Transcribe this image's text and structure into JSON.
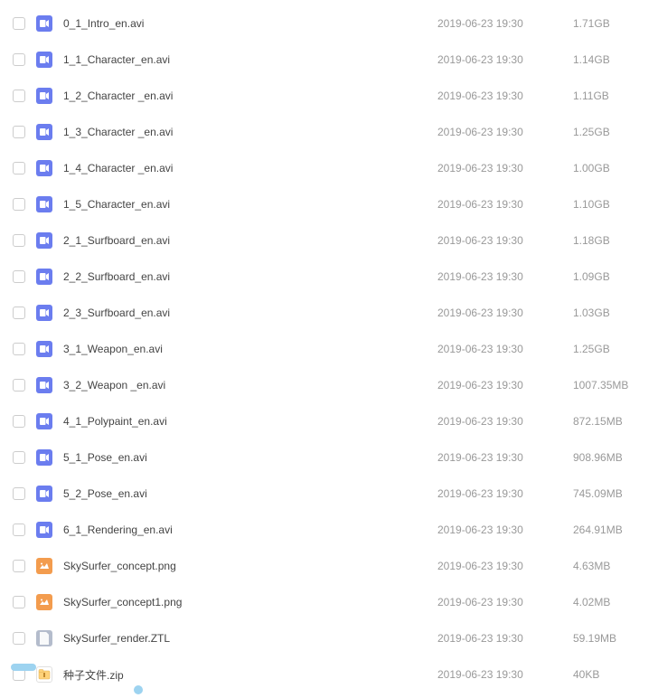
{
  "files": [
    {
      "name": "0_1_Intro_en.avi",
      "date": "2019-06-23 19:30",
      "size": "1.71GB",
      "type": "video"
    },
    {
      "name": "1_1_Character_en.avi",
      "date": "2019-06-23 19:30",
      "size": "1.14GB",
      "type": "video"
    },
    {
      "name": "1_2_Character _en.avi",
      "date": "2019-06-23 19:30",
      "size": "1.11GB",
      "type": "video"
    },
    {
      "name": "1_3_Character _en.avi",
      "date": "2019-06-23 19:30",
      "size": "1.25GB",
      "type": "video"
    },
    {
      "name": "1_4_Character _en.avi",
      "date": "2019-06-23 19:30",
      "size": "1.00GB",
      "type": "video"
    },
    {
      "name": "1_5_Character_en.avi",
      "date": "2019-06-23 19:30",
      "size": "1.10GB",
      "type": "video"
    },
    {
      "name": "2_1_Surfboard_en.avi",
      "date": "2019-06-23 19:30",
      "size": "1.18GB",
      "type": "video"
    },
    {
      "name": "2_2_Surfboard_en.avi",
      "date": "2019-06-23 19:30",
      "size": "1.09GB",
      "type": "video"
    },
    {
      "name": "2_3_Surfboard_en.avi",
      "date": "2019-06-23 19:30",
      "size": "1.03GB",
      "type": "video"
    },
    {
      "name": "3_1_Weapon_en.avi",
      "date": "2019-06-23 19:30",
      "size": "1.25GB",
      "type": "video"
    },
    {
      "name": "3_2_Weapon _en.avi",
      "date": "2019-06-23 19:30",
      "size": "1007.35MB",
      "type": "video"
    },
    {
      "name": "4_1_Polypaint_en.avi",
      "date": "2019-06-23 19:30",
      "size": "872.15MB",
      "type": "video"
    },
    {
      "name": "5_1_Pose_en.avi",
      "date": "2019-06-23 19:30",
      "size": "908.96MB",
      "type": "video"
    },
    {
      "name": "5_2_Pose_en.avi",
      "date": "2019-06-23 19:30",
      "size": "745.09MB",
      "type": "video"
    },
    {
      "name": "6_1_Rendering_en.avi",
      "date": "2019-06-23 19:30",
      "size": "264.91MB",
      "type": "video"
    },
    {
      "name": "SkySurfer_concept.png",
      "date": "2019-06-23 19:30",
      "size": "4.63MB",
      "type": "image"
    },
    {
      "name": "SkySurfer_concept1.png",
      "date": "2019-06-23 19:30",
      "size": "4.02MB",
      "type": "image"
    },
    {
      "name": "SkySurfer_render.ZTL",
      "date": "2019-06-23 19:30",
      "size": "59.19MB",
      "type": "generic"
    },
    {
      "name": "种子文件.zip",
      "date": "2019-06-23 19:30",
      "size": "40KB",
      "type": "zip"
    }
  ],
  "icons": {
    "video": "video-file-icon",
    "image": "image-file-icon",
    "generic": "generic-file-icon",
    "zip": "zip-file-icon"
  }
}
